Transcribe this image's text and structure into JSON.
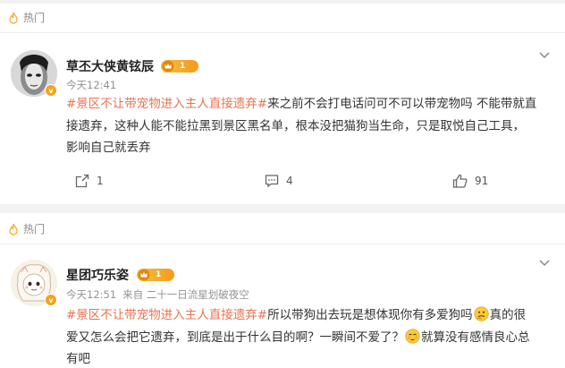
{
  "posts": [
    {
      "hot_label": "热门",
      "user_name": "草丕大侠黄铉辰",
      "level": "1",
      "time": "今天12:41",
      "source": "",
      "hashtag": "#景区不让带宠物进入主人直接遗弃#",
      "text_lines": [
        "来之前不会打电话问可不可以带宠物吗 不能带就直",
        "接遗弃，这种人能不能拉黑到景区黑名单，根本没把猫狗当生命，只是取悦自己工具，",
        "影响自己就丢弃"
      ],
      "reposts": "1",
      "comments": "4",
      "likes": "91"
    },
    {
      "hot_label": "热门",
      "user_name": "星团巧乐姿",
      "level": "1",
      "time": "今天12:51",
      "source": "来自 二十一日流星划破夜空",
      "hashtag": "#景区不让带宠物进入主人直接遗弃#",
      "line1_a": "所以带狗出去玩是想体现你有多爱狗吗",
      "line1_b": "真的很",
      "line2_a": "爱又怎么会把它遗弃，到底是出于什么目的啊？一瞬间不爱了？",
      "line2_b": "就算没有感情良心总",
      "line3": "有吧"
    }
  ],
  "colors": {
    "hashtag": "#eb7350",
    "badge": "#f7a21a",
    "background_gap": "#f2f2f2"
  },
  "icons": [
    "flame-icon",
    "verified-badge-icon",
    "crown-icon",
    "chevron-down-icon",
    "repost-icon",
    "comment-icon",
    "like-icon",
    "thinking-emoji-icon",
    "shy-emoji-icon"
  ]
}
